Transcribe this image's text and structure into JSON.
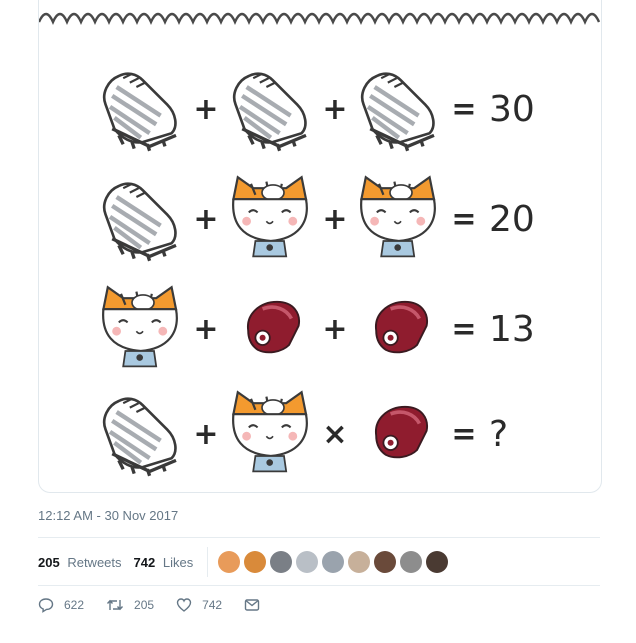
{
  "puzzle": {
    "rows": [
      {
        "a": "shoe",
        "op1": "+",
        "b": "shoe",
        "op2": "+",
        "c": "shoe",
        "eq": "=",
        "result": "30"
      },
      {
        "a": "shoe",
        "op1": "+",
        "b": "cat",
        "op2": "+",
        "c": "cat",
        "eq": "=",
        "result": "20"
      },
      {
        "a": "cat",
        "op1": "+",
        "b": "whistle",
        "op2": "+",
        "c": "whistle",
        "eq": "=",
        "result": "13"
      },
      {
        "a": "shoe",
        "op1": "+",
        "b": "cat",
        "op2": "×",
        "c": "whistle",
        "eq": "=",
        "result": "?"
      }
    ]
  },
  "tweet": {
    "timestamp": "12:12 AM - 30 Nov 2017",
    "retweets_count": "205",
    "retweets_label": "Retweets",
    "likes_count": "742",
    "likes_label": "Likes",
    "liker_avatars": [
      "#e89b5a",
      "#d98a3a",
      "#7a7f86",
      "#b9bfc6",
      "#9aa3ad",
      "#c7b09a",
      "#6a4a3a",
      "#8d8d8d",
      "#4a3a32"
    ],
    "actions": {
      "reply_count": "622",
      "retweet_count": "205",
      "like_count": "742"
    }
  },
  "icons": [
    "reply-icon",
    "retweet-icon",
    "heart-icon",
    "message-icon"
  ],
  "colors": {
    "muted": "#657786",
    "text": "#14171a",
    "divider": "#e6ecf0",
    "shoe_stripe": "#c0c4c8",
    "cat_cap": "#f39a2f",
    "whistle": "#8f1c2e"
  }
}
